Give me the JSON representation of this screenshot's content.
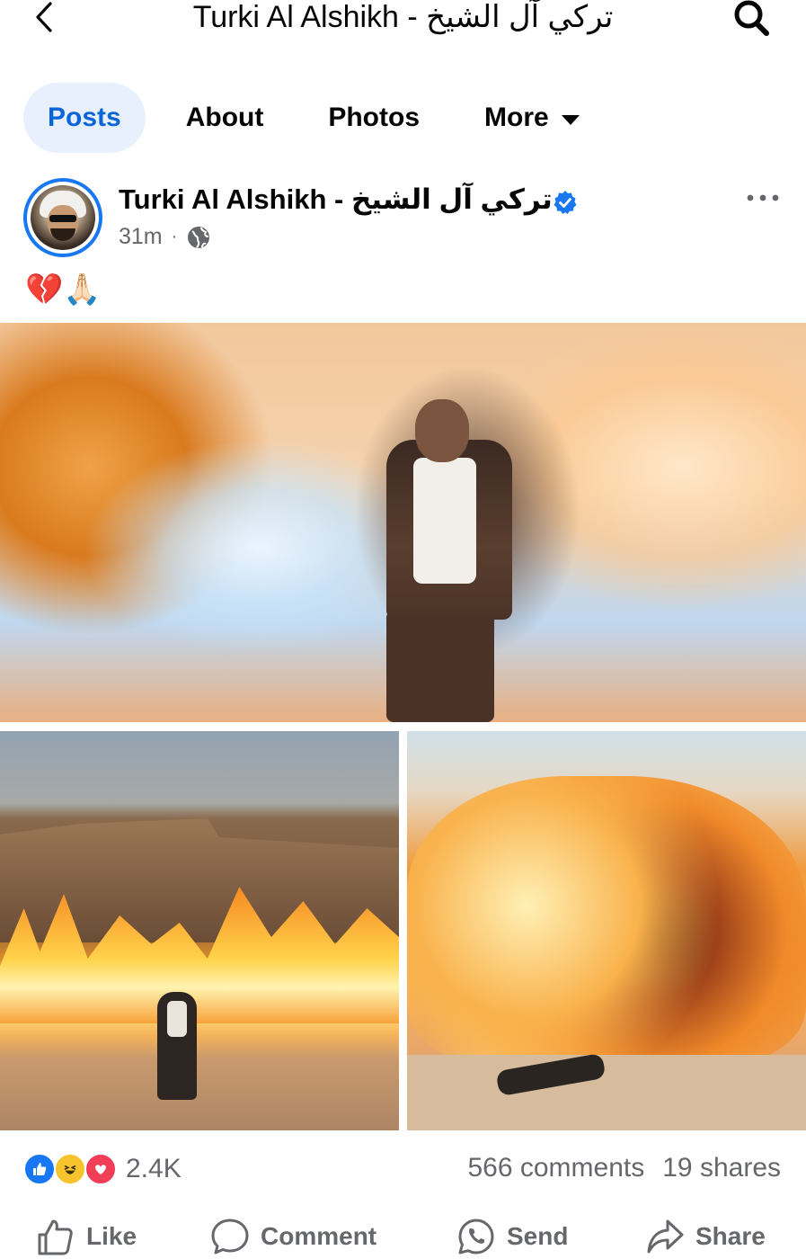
{
  "header": {
    "title": "Turki Al Alshikh - تركي آل الشيخ",
    "back_icon": "chevron-left-icon",
    "search_icon": "search-icon"
  },
  "tabs": [
    {
      "label": "Posts",
      "active": true
    },
    {
      "label": "About",
      "active": false
    },
    {
      "label": "Photos",
      "active": false
    },
    {
      "label": "More",
      "active": false
    }
  ],
  "post": {
    "author": "Turki Al Alshikh - تركي آل الشيخ",
    "verified": true,
    "time": "31m",
    "audience_icon": "globe-icon",
    "text": "💔🙏🏻",
    "photos": [
      {
        "description_icon": "photo-explosion-man-walking"
      },
      {
        "description_icon": "photo-desert-explosion-runner"
      },
      {
        "description_icon": "photo-fireball-man-fallen"
      }
    ]
  },
  "stats": {
    "reactions": [
      "like",
      "haha",
      "love"
    ],
    "reaction_count": "2.4K",
    "comments": "566 comments",
    "shares": "19 shares"
  },
  "actions": {
    "like": "Like",
    "comment": "Comment",
    "send": "Send",
    "share": "Share"
  },
  "colors": {
    "accent": "#1877f2",
    "active_tab_bg": "#e7f0fc",
    "secondary_text": "#65676b"
  }
}
